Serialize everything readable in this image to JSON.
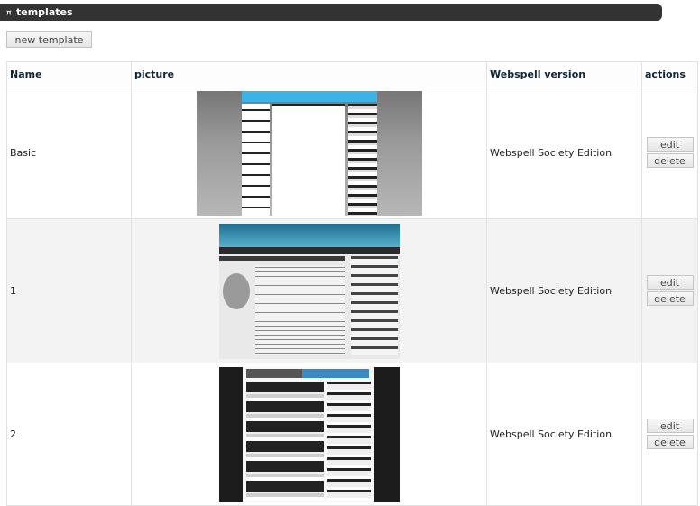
{
  "header": {
    "icon": "¤",
    "title": "templates"
  },
  "toolbar": {
    "new_template_label": "new template"
  },
  "table": {
    "columns": [
      "Name",
      "picture",
      "Webspell version",
      "actions"
    ],
    "rows": [
      {
        "name": "Basic",
        "version": "Webspell Society Edition",
        "edit_label": "edit",
        "delete_label": "delete"
      },
      {
        "name": "1",
        "version": "Webspell Society Edition",
        "edit_label": "edit",
        "delete_label": "delete"
      },
      {
        "name": "2",
        "version": "Webspell Society Edition",
        "edit_label": "edit",
        "delete_label": "delete"
      }
    ]
  }
}
